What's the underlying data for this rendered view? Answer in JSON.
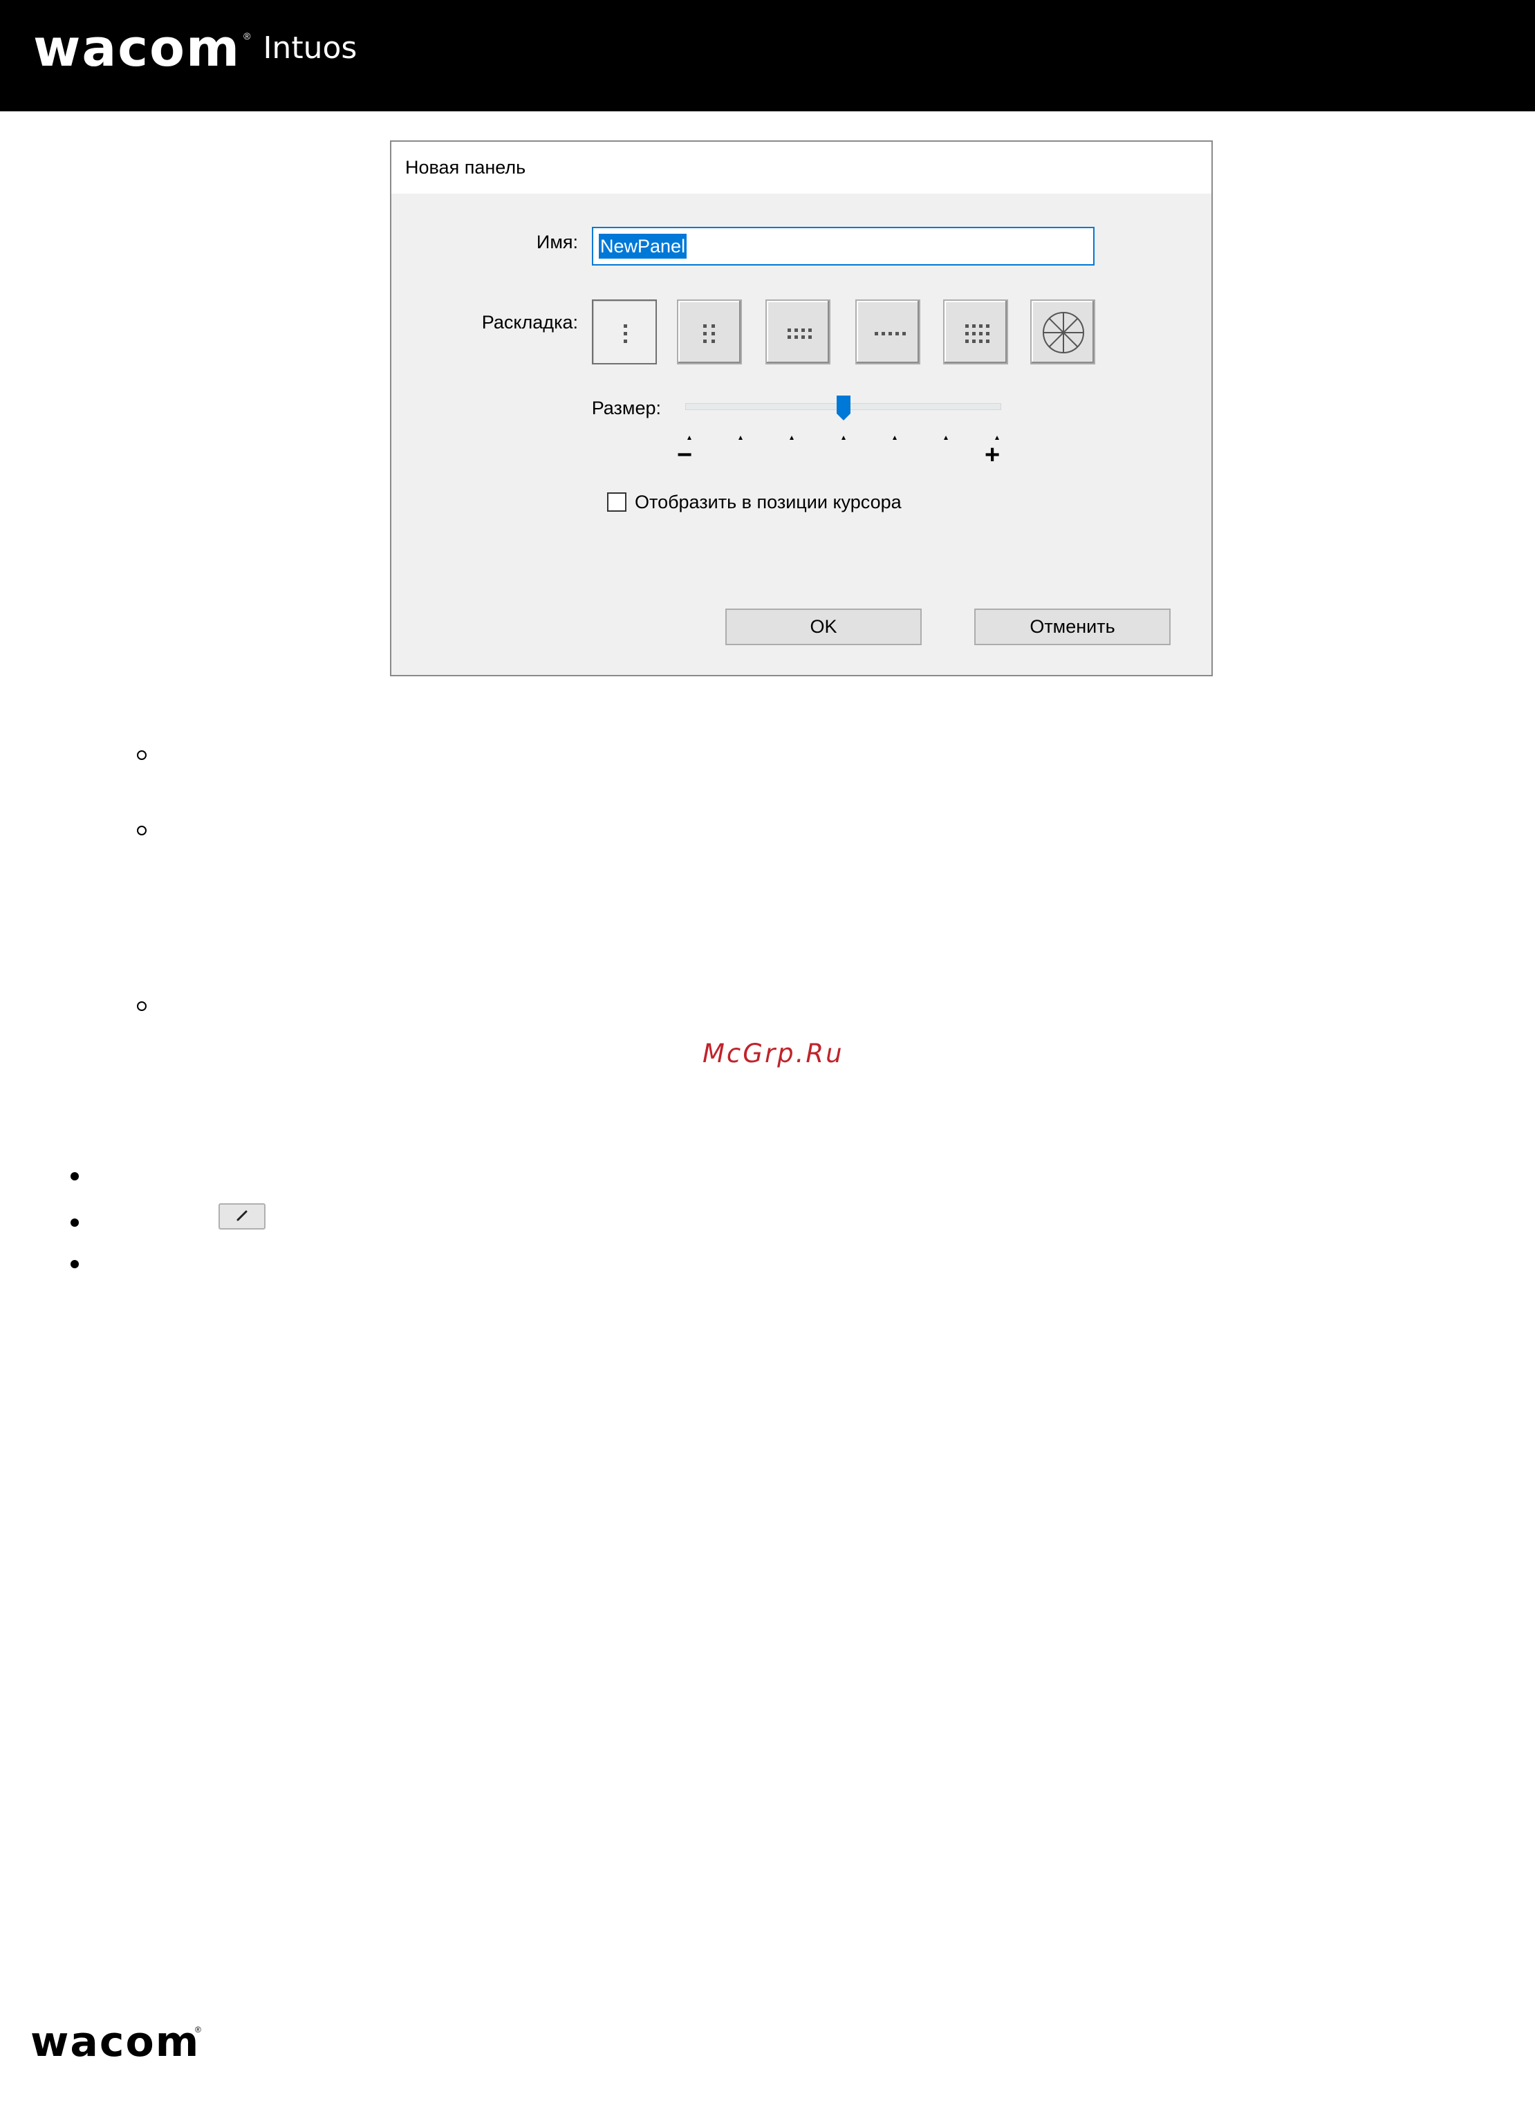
{
  "header": {
    "brand": "wacom",
    "registered_mark": "®",
    "product": "Intuos"
  },
  "dialog": {
    "title": "Новая панель",
    "name_label": "Имя:",
    "name_value": "NewPanel",
    "layout_label": "Раскладка:",
    "layouts": [
      {
        "icon": "layout-1col-icon",
        "selected": true
      },
      {
        "icon": "layout-2col-icon",
        "selected": false
      },
      {
        "icon": "layout-3col-icon",
        "selected": false
      },
      {
        "icon": "layout-row-icon",
        "selected": false
      },
      {
        "icon": "layout-grid-icon",
        "selected": false
      },
      {
        "icon": "layout-radial-icon",
        "selected": false
      }
    ],
    "size_label": "Размер:",
    "size_min_symbol": "−",
    "size_max_symbol": "+",
    "size_level": 4,
    "size_steps": 7,
    "checkbox_label": "Отобразить в позиции курсора",
    "checkbox_checked": false,
    "ok_label": "OK",
    "cancel_label": "Отменить"
  },
  "watermark": "McGrp.Ru",
  "footer": {
    "brand": "wacom",
    "registered_mark": "®"
  },
  "colors": {
    "accent": "#0078d7",
    "watermark": "#c0232b"
  }
}
